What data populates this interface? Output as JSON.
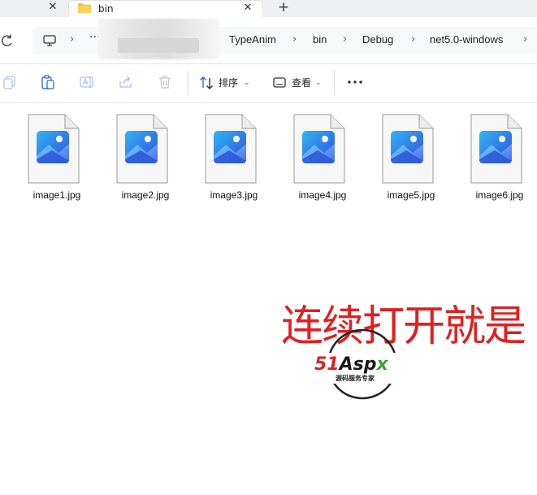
{
  "tabs": {
    "active_title": "bin",
    "close_glyph": "✕",
    "new_tab_glyph": "+"
  },
  "address": {
    "separator": "›",
    "more": "···",
    "crumbs": [
      "TypeAnim",
      "bin",
      "Debug",
      "net5.0-windows"
    ]
  },
  "toolbar": {
    "sort_label": "排序",
    "view_label": "查看",
    "caret": "⌄",
    "icons": [
      "copy-icon",
      "paste-icon",
      "rename-icon",
      "share-icon",
      "delete-icon",
      "sort-icon",
      "view-icon",
      "more-icon"
    ]
  },
  "files": [
    {
      "name": "image1.jpg"
    },
    {
      "name": "image2.jpg"
    },
    {
      "name": "image3.jpg"
    },
    {
      "name": "image4.jpg"
    },
    {
      "name": "image5.jpg"
    },
    {
      "name": "image6.jpg"
    }
  ],
  "overlay": {
    "caption": "连续打开就是",
    "watermark_logo": "51Aspx",
    "watermark_tagline": "源码服务专家"
  },
  "colors": {
    "accent_blue": "#1a73e8",
    "caption_red": "#e02020",
    "folder_yellow": "#f5c542",
    "watermark_green": "#3aa335"
  }
}
